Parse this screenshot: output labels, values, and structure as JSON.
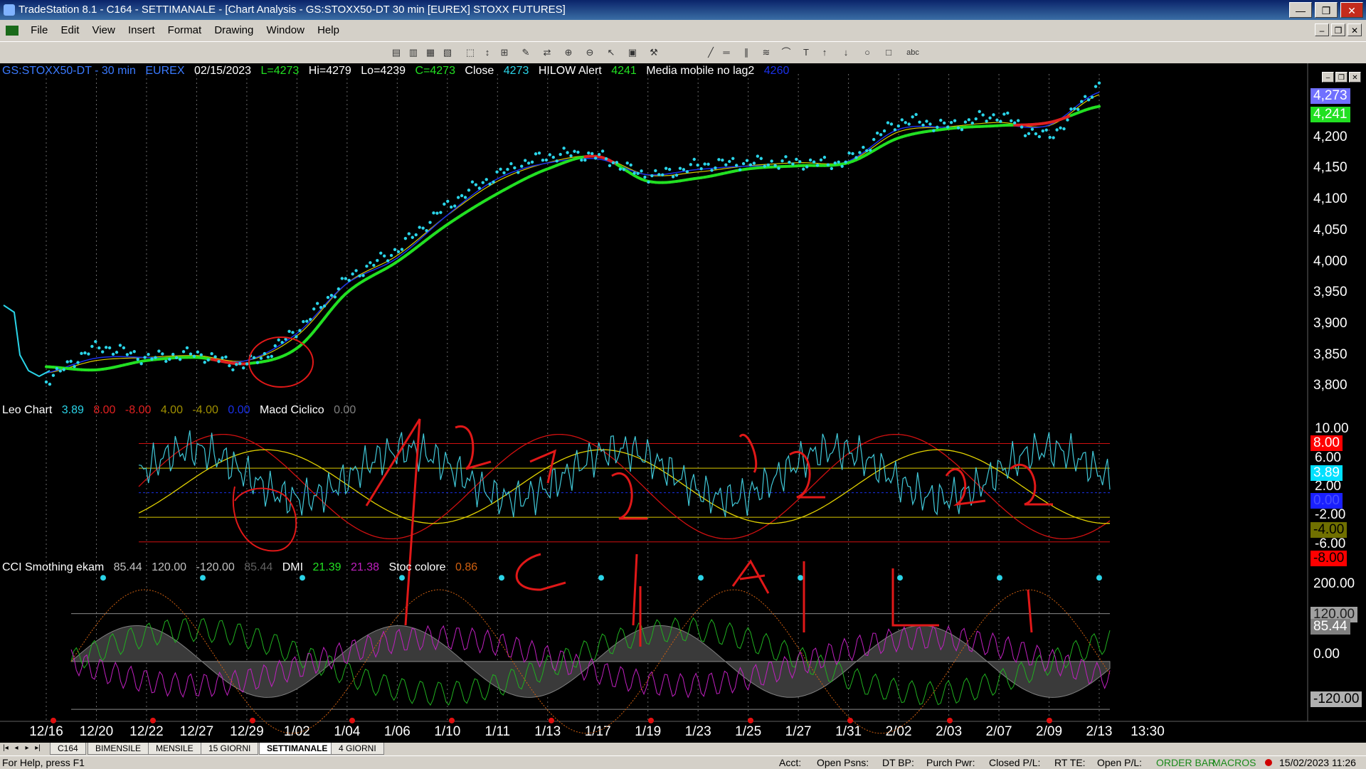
{
  "window": {
    "title": "TradeStation 8.1 - C164 - SETTIMANALE - [Chart Analysis - GS:STOXX50-DT  30 min  [EUREX] STOXX FUTURES]",
    "buttons": [
      "—",
      "❒",
      "✕"
    ]
  },
  "menu": [
    "File",
    "Edit",
    "View",
    "Insert",
    "Format",
    "Drawing",
    "Window",
    "Help"
  ],
  "mdi_buttons": [
    "–",
    "❒",
    "✕"
  ],
  "toolbar_icons": [
    "new-chart-icon",
    "open-icon",
    "save-icon",
    "print-icon",
    "chart-type-icon",
    "bar-icon",
    "candle-icon",
    "line-icon",
    "scroll-icon",
    "zoom-in-icon",
    "zoom-out-icon",
    "pointer-icon",
    "data-window-icon",
    "tools-icon",
    "trendline-icon",
    "horizontal-line-icon",
    "channel-icon",
    "fibonacci-icon",
    "arc-icon",
    "text-icon",
    "arrow-up-icon",
    "arrow-down-icon",
    "ellipse-icon",
    "rectangle-icon",
    "abc-text-icon"
  ],
  "toolbar_text": [
    "abc"
  ],
  "price_header": {
    "symbol": "GS:STOXX50-DT - 30 min",
    "exchange": "EUREX",
    "date": "02/15/2023",
    "last": "L=4273",
    "high": "Hi=4279",
    "low": "Lo=4239",
    "close_eq": "C=4273",
    "close_label": "Close",
    "close_value": "4273",
    "hilow_label": "HILOW Alert",
    "hilow_value": "4241",
    "ma_label": "Media mobile no lag2",
    "ma_value": "4260"
  },
  "leo_header": {
    "label": "Leo Chart",
    "v1": "3.89",
    "v2": "8.00",
    "v3": "-8.00",
    "v4": "4.00",
    "v5": "-4.00",
    "v6": "0.00",
    "macd_label": "Macd Ciclico",
    "macd_value": "0.00"
  },
  "cci_header": {
    "label": "CCI Smothing ekam",
    "v1": "85.44",
    "v2": "120.00",
    "v3": "-120.00",
    "v4": "85.44",
    "dmi_label": "DMI",
    "dmi_plus": "21.39",
    "dmi_minus": "21.38",
    "stoc_label": "Stoc colore",
    "stoc_value": "0.86"
  },
  "price_axis": [
    "4,200",
    "4,150",
    "4,100",
    "4,050",
    "4,000",
    "3,950",
    "3,900",
    "3,850",
    "3,800"
  ],
  "price_tags": {
    "close": "4,273",
    "hilow": "4,241"
  },
  "leo_axis": [
    "10.00",
    "6.00",
    "2.00",
    "-2.00",
    "-6.00"
  ],
  "leo_tags": {
    "v8": "8.00",
    "v389": "3.89",
    "v0": "0.00",
    "vm4": "-4.00",
    "vm8": "-8.00"
  },
  "cci_axis": [
    "200.00",
    "0.00"
  ],
  "cci_tags": {
    "v120": "120.00",
    "v85": "85.44",
    "vm120": "-120.00"
  },
  "x_axis": [
    "12/16",
    "12/20",
    "12/22",
    "12/27",
    "12/29",
    "1/02",
    "1/04",
    "1/06",
    "1/10",
    "1/11",
    "1/13",
    "1/17",
    "1/19",
    "1/23",
    "1/25",
    "1/27",
    "1/31",
    "2/02",
    "2/03",
    "2/07",
    "2/09",
    "2/13",
    "13:30"
  ],
  "tabs": [
    "C164",
    "BIMENSILE",
    "MENSILE",
    "15 GIORNI",
    "SETTIMANALE",
    "4 GIORNI"
  ],
  "active_tab": "SETTIMANALE",
  "status": {
    "help": "For Help, press F1",
    "acct": "Acct:",
    "open_psns": "Open Psns:",
    "dt_bp": "DT BP:",
    "purch_pwr": "Purch Pwr:",
    "closed_pl": "Closed P/L:",
    "rt_te": "RT TE:",
    "open_pl": "Open P/L:",
    "order_bar": "ORDER BAR",
    "macros": "MACROS",
    "datetime": "15/02/2023 11:26"
  },
  "colors": {
    "price": "#2ad4e8",
    "ma_green": "#22e022",
    "ma_red": "#e02020",
    "ma_blue": "#1a30e8",
    "ma_yellow": "#d8c800",
    "osc_cyan": "#40c8d8",
    "osc_red": "#d01010",
    "osc_yellow": "#e0d000",
    "cci_magenta": "#c020c0",
    "cci_green": "#20b020",
    "cci_orange": "#d06010",
    "cci_gray": "#808080"
  },
  "chart_data": {
    "type": "line",
    "title": "GS:STOXX50-DT - 30 min",
    "x": [
      "12/16",
      "12/20",
      "12/22",
      "12/27",
      "12/29",
      "1/02",
      "1/04",
      "1/06",
      "1/10",
      "1/11",
      "1/13",
      "1/17",
      "1/19",
      "1/23",
      "1/25",
      "1/27",
      "1/31",
      "2/02",
      "2/03",
      "2/07",
      "2/09",
      "2/13"
    ],
    "series": [
      {
        "name": "Close",
        "values": [
          3800,
          3850,
          3835,
          3840,
          3825,
          3880,
          3960,
          4010,
          4080,
          4130,
          4160,
          4160,
          4130,
          4145,
          4150,
          4150,
          4155,
          4215,
          4210,
          4225,
          4195,
          4273
        ]
      },
      {
        "name": "HILOW Alert",
        "values": [
          3820,
          3815,
          3830,
          3835,
          3825,
          3850,
          3940,
          3990,
          4050,
          4100,
          4140,
          4160,
          4120,
          4125,
          4140,
          4145,
          4150,
          4190,
          4205,
          4210,
          4215,
          4241
        ]
      },
      {
        "name": "Media mobile no lag2",
        "values": [
          3810,
          3830,
          3835,
          3838,
          3830,
          3870,
          3955,
          4000,
          4065,
          4120,
          4150,
          4160,
          4130,
          4135,
          4145,
          4150,
          4152,
          4200,
          4208,
          4215,
          4210,
          4260
        ]
      }
    ],
    "ylim": [
      3770,
      4290
    ],
    "panels": [
      {
        "name": "Leo Chart",
        "ylim": [
          -10,
          12
        ],
        "levels": [
          8,
          4,
          0,
          -4,
          -8
        ],
        "last": 3.89
      },
      {
        "name": "CCI Smothing ekam",
        "ylim": [
          -150,
          230
        ],
        "levels": [
          120,
          0,
          -120
        ],
        "last": 85.44
      }
    ]
  }
}
